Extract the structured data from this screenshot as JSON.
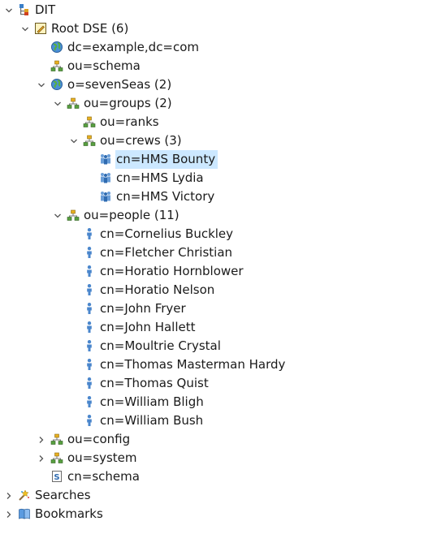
{
  "tree": {
    "rows": [
      {
        "name": "dit",
        "label": "DIT",
        "icon": "dit-icon",
        "indent": 0,
        "toggle": "expanded"
      },
      {
        "name": "root-dse",
        "label": "Root DSE (6)",
        "icon": "root-dse-icon",
        "indent": 1,
        "toggle": "expanded"
      },
      {
        "name": "dc-example-com",
        "label": "dc=example,dc=com",
        "icon": "globe-icon",
        "indent": 2,
        "toggle": "none"
      },
      {
        "name": "ou-schema",
        "label": "ou=schema",
        "icon": "org-unit-icon",
        "indent": 2,
        "toggle": "none"
      },
      {
        "name": "o-sevenseas",
        "label": "o=sevenSeas (2)",
        "icon": "globe-icon",
        "indent": 2,
        "toggle": "expanded"
      },
      {
        "name": "ou-groups",
        "label": "ou=groups (2)",
        "icon": "org-unit-icon",
        "indent": 3,
        "toggle": "expanded"
      },
      {
        "name": "ou-ranks",
        "label": "ou=ranks",
        "icon": "org-unit-icon",
        "indent": 4,
        "toggle": "none"
      },
      {
        "name": "ou-crews",
        "label": "ou=crews (3)",
        "icon": "org-unit-icon",
        "indent": 4,
        "toggle": "expanded"
      },
      {
        "name": "cn-hms-bounty",
        "label": "cn=HMS Bounty",
        "icon": "group-icon",
        "indent": 5,
        "toggle": "none",
        "selected": true
      },
      {
        "name": "cn-hms-lydia",
        "label": "cn=HMS Lydia",
        "icon": "group-icon",
        "indent": 5,
        "toggle": "none"
      },
      {
        "name": "cn-hms-victory",
        "label": "cn=HMS Victory",
        "icon": "group-icon",
        "indent": 5,
        "toggle": "none"
      },
      {
        "name": "ou-people",
        "label": "ou=people (11)",
        "icon": "org-unit-icon",
        "indent": 3,
        "toggle": "expanded"
      },
      {
        "name": "cn-cornelius-buckley",
        "label": "cn=Cornelius Buckley",
        "icon": "person-icon",
        "indent": 4,
        "toggle": "none"
      },
      {
        "name": "cn-fletcher-christian",
        "label": "cn=Fletcher Christian",
        "icon": "person-icon",
        "indent": 4,
        "toggle": "none"
      },
      {
        "name": "cn-horatio-hornblower",
        "label": "cn=Horatio Hornblower",
        "icon": "person-icon",
        "indent": 4,
        "toggle": "none"
      },
      {
        "name": "cn-horatio-nelson",
        "label": "cn=Horatio Nelson",
        "icon": "person-icon",
        "indent": 4,
        "toggle": "none"
      },
      {
        "name": "cn-john-fryer",
        "label": "cn=John Fryer",
        "icon": "person-icon",
        "indent": 4,
        "toggle": "none"
      },
      {
        "name": "cn-john-hallett",
        "label": "cn=John Hallett",
        "icon": "person-icon",
        "indent": 4,
        "toggle": "none"
      },
      {
        "name": "cn-moultrie-crystal",
        "label": "cn=Moultrie Crystal",
        "icon": "person-icon",
        "indent": 4,
        "toggle": "none"
      },
      {
        "name": "cn-thomas-masterman-hardy",
        "label": "cn=Thomas Masterman Hardy",
        "icon": "person-icon",
        "indent": 4,
        "toggle": "none"
      },
      {
        "name": "cn-thomas-quist",
        "label": "cn=Thomas Quist",
        "icon": "person-icon",
        "indent": 4,
        "toggle": "none"
      },
      {
        "name": "cn-william-bligh",
        "label": "cn=William Bligh",
        "icon": "person-icon",
        "indent": 4,
        "toggle": "none"
      },
      {
        "name": "cn-william-bush",
        "label": "cn=William Bush",
        "icon": "person-icon",
        "indent": 4,
        "toggle": "none"
      },
      {
        "name": "ou-config",
        "label": "ou=config",
        "icon": "org-unit-icon",
        "indent": 2,
        "toggle": "collapsed"
      },
      {
        "name": "ou-system",
        "label": "ou=system",
        "icon": "org-unit-icon",
        "indent": 2,
        "toggle": "collapsed"
      },
      {
        "name": "cn-schema",
        "label": "cn=schema",
        "icon": "schema-icon",
        "indent": 2,
        "toggle": "none"
      },
      {
        "name": "searches",
        "label": "Searches",
        "icon": "searches-icon",
        "indent": 0,
        "toggle": "collapsed"
      },
      {
        "name": "bookmarks",
        "label": "Bookmarks",
        "icon": "bookmarks-icon",
        "indent": 0,
        "toggle": "collapsed"
      }
    ]
  },
  "colors": {
    "selection": "#cce8ff",
    "text": "#1a1a1a",
    "chevron": "#555555"
  }
}
